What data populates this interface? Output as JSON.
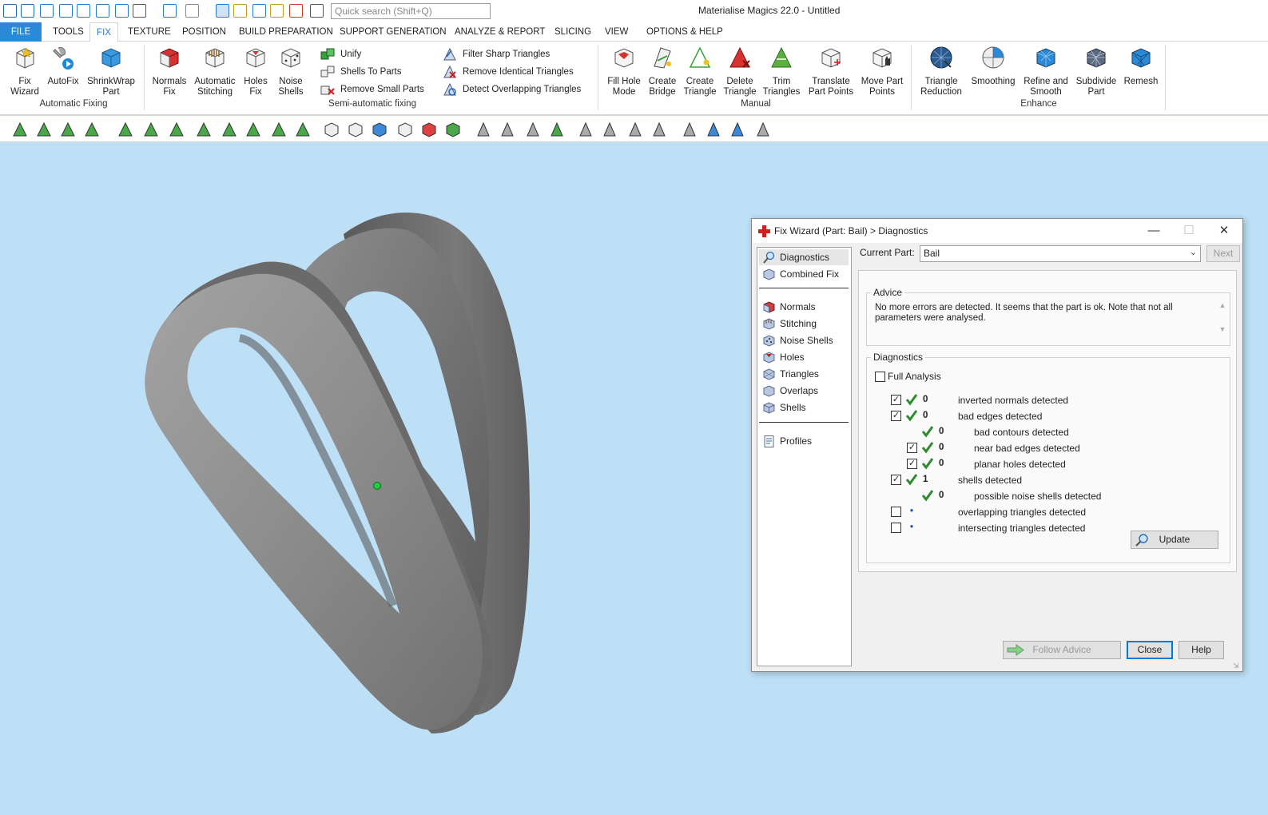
{
  "app": {
    "title": "Materialise Magics 22.0 - Untitled",
    "search_placeholder": "Quick search (Shift+Q)"
  },
  "quick_access": [
    "magics-logo-icon",
    "new-icon",
    "open-icon",
    "save-icon",
    "save-as-icon",
    "import-part-icon",
    "save-part-icon",
    "unload-part-icon",
    "undo-icon",
    "redo-icon",
    "select-mode-icon",
    "zoom-icon",
    "zoom-fit-icon",
    "search-part-icon",
    "find-icon",
    "settings-icon"
  ],
  "tabs": [
    {
      "label": "FILE"
    },
    {
      "label": "TOOLS"
    },
    {
      "label": "FIX"
    },
    {
      "label": "TEXTURE"
    },
    {
      "label": "POSITION"
    },
    {
      "label": "BUILD PREPARATION"
    },
    {
      "label": "SUPPORT GENERATION"
    },
    {
      "label": "ANALYZE & REPORT"
    },
    {
      "label": "SLICING"
    },
    {
      "label": "VIEW"
    },
    {
      "label": "OPTIONS & HELP"
    }
  ],
  "ribbon": {
    "automatic_fixing": {
      "label": "Automatic Fixing",
      "items": [
        {
          "line1": "Fix",
          "line2": "Wizard"
        },
        {
          "line1": "AutoFix",
          "line2": ""
        },
        {
          "line1": "ShrinkWrap",
          "line2": "Part"
        }
      ]
    },
    "semi_automatic": {
      "label": "Semi-automatic fixing",
      "large": [
        {
          "line1": "Normals",
          "line2": "Fix"
        },
        {
          "line1": "Automatic",
          "line2": "Stitching"
        },
        {
          "line1": "Holes",
          "line2": "Fix"
        },
        {
          "line1": "Noise",
          "line2": "Shells"
        }
      ],
      "small": [
        "Unify",
        "Shells To Parts",
        "Remove Small Parts",
        "Filter Sharp Triangles",
        "Remove Identical Triangles",
        "Detect Overlapping Triangles"
      ]
    },
    "manual": {
      "label": "Manual",
      "items": [
        {
          "line1": "Fill Hole",
          "line2": "Mode"
        },
        {
          "line1": "Create",
          "line2": "Bridge"
        },
        {
          "line1": "Create",
          "line2": "Triangle"
        },
        {
          "line1": "Delete",
          "line2": "Triangle"
        },
        {
          "line1": "Trim",
          "line2": "Triangles"
        },
        {
          "line1": "Translate",
          "line2": "Part Points"
        },
        {
          "line1": "Move Part",
          "line2": "Points"
        }
      ]
    },
    "enhance": {
      "label": "Enhance",
      "items": [
        {
          "line1": "Triangle",
          "line2": "Reduction"
        },
        {
          "line1": "Smoothing",
          "line2": ""
        },
        {
          "line1": "Refine and",
          "line2": "Smooth"
        },
        {
          "line1": "Subdivide",
          "line2": "Part"
        },
        {
          "line1": "Remesh",
          "line2": ""
        }
      ]
    }
  },
  "dialog": {
    "title": "Fix Wizard (Part: Bail) > Diagnostics",
    "nav": [
      "Diagnostics",
      "Combined Fix",
      "Normals",
      "Stitching",
      "Noise Shells",
      "Holes",
      "Triangles",
      "Overlaps",
      "Shells",
      "Profiles"
    ],
    "current_part_label": "Current Part:",
    "current_part_value": "Bail",
    "next_label": "Next",
    "advice_legend": "Advice",
    "advice_text": "No more errors are detected. It seems that the part is ok. Note that not all parameters were analysed.",
    "diagnostics_legend": "Diagnostics",
    "full_analysis_label": "Full Analysis",
    "rows": [
      {
        "checked": true,
        "status": "ok",
        "value": "0",
        "label": "inverted normals detected",
        "indent": 0,
        "has_checkbox": true
      },
      {
        "checked": true,
        "status": "ok",
        "value": "0",
        "label": "bad edges detected",
        "indent": 0,
        "has_checkbox": true
      },
      {
        "checked": false,
        "status": "ok",
        "value": "0",
        "label": "bad contours detected",
        "indent": 1,
        "has_checkbox": false
      },
      {
        "checked": true,
        "status": "ok",
        "value": "0",
        "label": "near bad edges detected",
        "indent": 1,
        "has_checkbox": true
      },
      {
        "checked": true,
        "status": "ok",
        "value": "0",
        "label": "planar holes detected",
        "indent": 1,
        "has_checkbox": true
      },
      {
        "checked": true,
        "status": "ok",
        "value": "1",
        "label": "shells detected",
        "indent": 0,
        "has_checkbox": true
      },
      {
        "checked": false,
        "status": "ok",
        "value": "0",
        "label": "possible noise shells detected",
        "indent": 1,
        "has_checkbox": false
      },
      {
        "checked": false,
        "status": "pending",
        "value": "•",
        "label": "overlapping triangles detected",
        "indent": 0,
        "has_checkbox": true
      },
      {
        "checked": false,
        "status": "pending",
        "value": "•",
        "label": "intersecting triangles detected",
        "indent": 0,
        "has_checkbox": true
      }
    ],
    "update_label": "Update",
    "follow_advice_label": "Follow Advice",
    "close_label": "Close",
    "help_label": "Help"
  },
  "colors": {
    "accent": "#2a8ad8",
    "viewport_bg": "#bde0f7",
    "model_gray": "#8a8a8a",
    "check_green": "#2e8b2e",
    "pivot_green": "#22cc44"
  }
}
